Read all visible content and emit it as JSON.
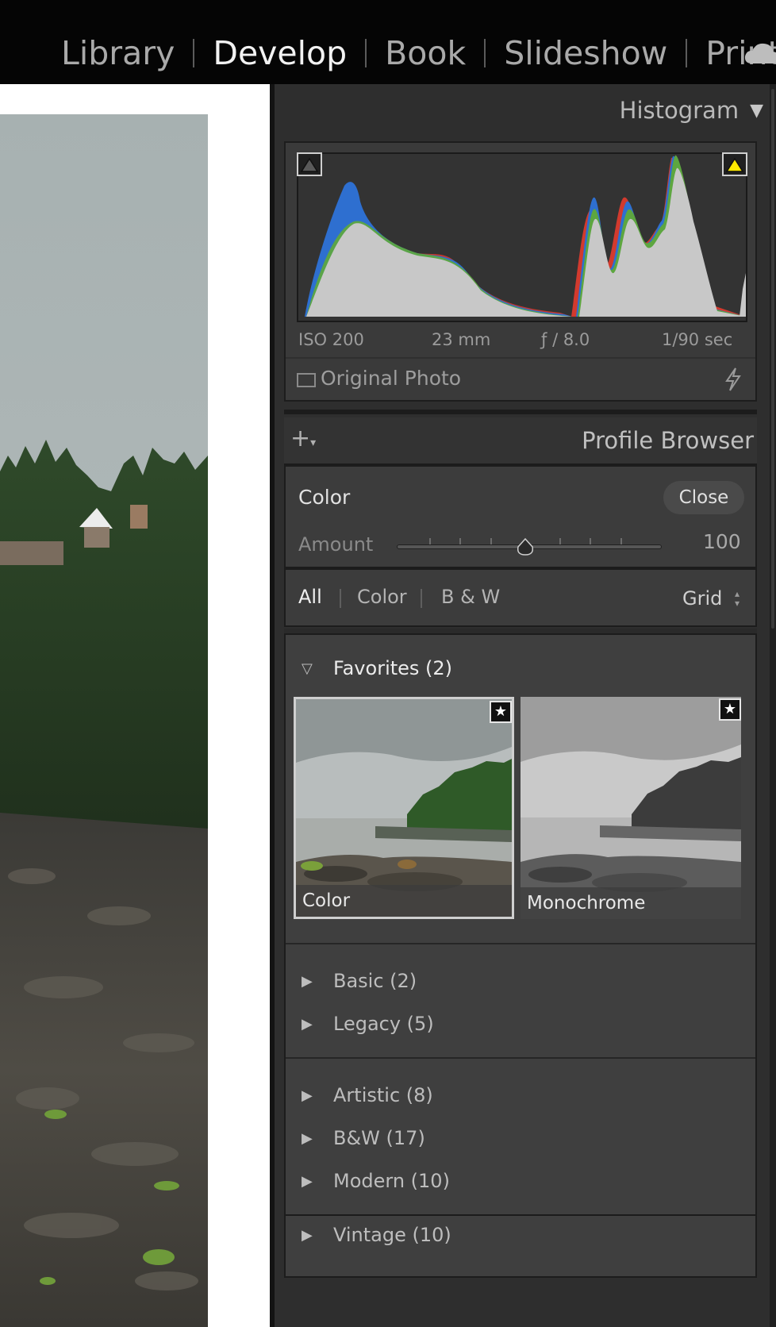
{
  "modules": [
    {
      "label": "Library",
      "active": false
    },
    {
      "label": "Develop",
      "active": true
    },
    {
      "label": "Book",
      "active": false
    },
    {
      "label": "Slideshow",
      "active": false
    },
    {
      "label": "Print",
      "active": false
    }
  ],
  "histogram": {
    "title": "Histogram",
    "exif": {
      "iso": "ISO 200",
      "focal": "23 mm",
      "aperture": "ƒ / 8.0",
      "shutter": "1/90 sec"
    },
    "original_photo_label": "Original Photo",
    "colors": {
      "red": "#d23a2e",
      "green": "#5da640",
      "blue": "#2e6fd0",
      "luma": "#c8c8c8",
      "highlight_clip": "#ffea00"
    }
  },
  "profile_browser": {
    "title": "Profile Browser",
    "current_profile": "Color",
    "close_label": "Close",
    "amount_label": "Amount",
    "amount_value": "100",
    "amount_fraction": 0.5,
    "filters": [
      {
        "label": "All",
        "active": true
      },
      {
        "label": "Color",
        "active": false
      },
      {
        "label": "B & W",
        "active": false
      }
    ],
    "view_label": "Grid",
    "favorites": {
      "label": "Favorites (2)",
      "items": [
        {
          "label": "Color",
          "selected": true
        },
        {
          "label": "Monochrome",
          "selected": false
        }
      ]
    },
    "groups_a": [
      {
        "label": "Basic (2)"
      },
      {
        "label": "Legacy (5)"
      }
    ],
    "groups_b": [
      {
        "label": "Artistic (8)"
      },
      {
        "label": "B&W (17)"
      },
      {
        "label": "Modern (10)"
      },
      {
        "label": "Vintage (10)"
      }
    ]
  }
}
